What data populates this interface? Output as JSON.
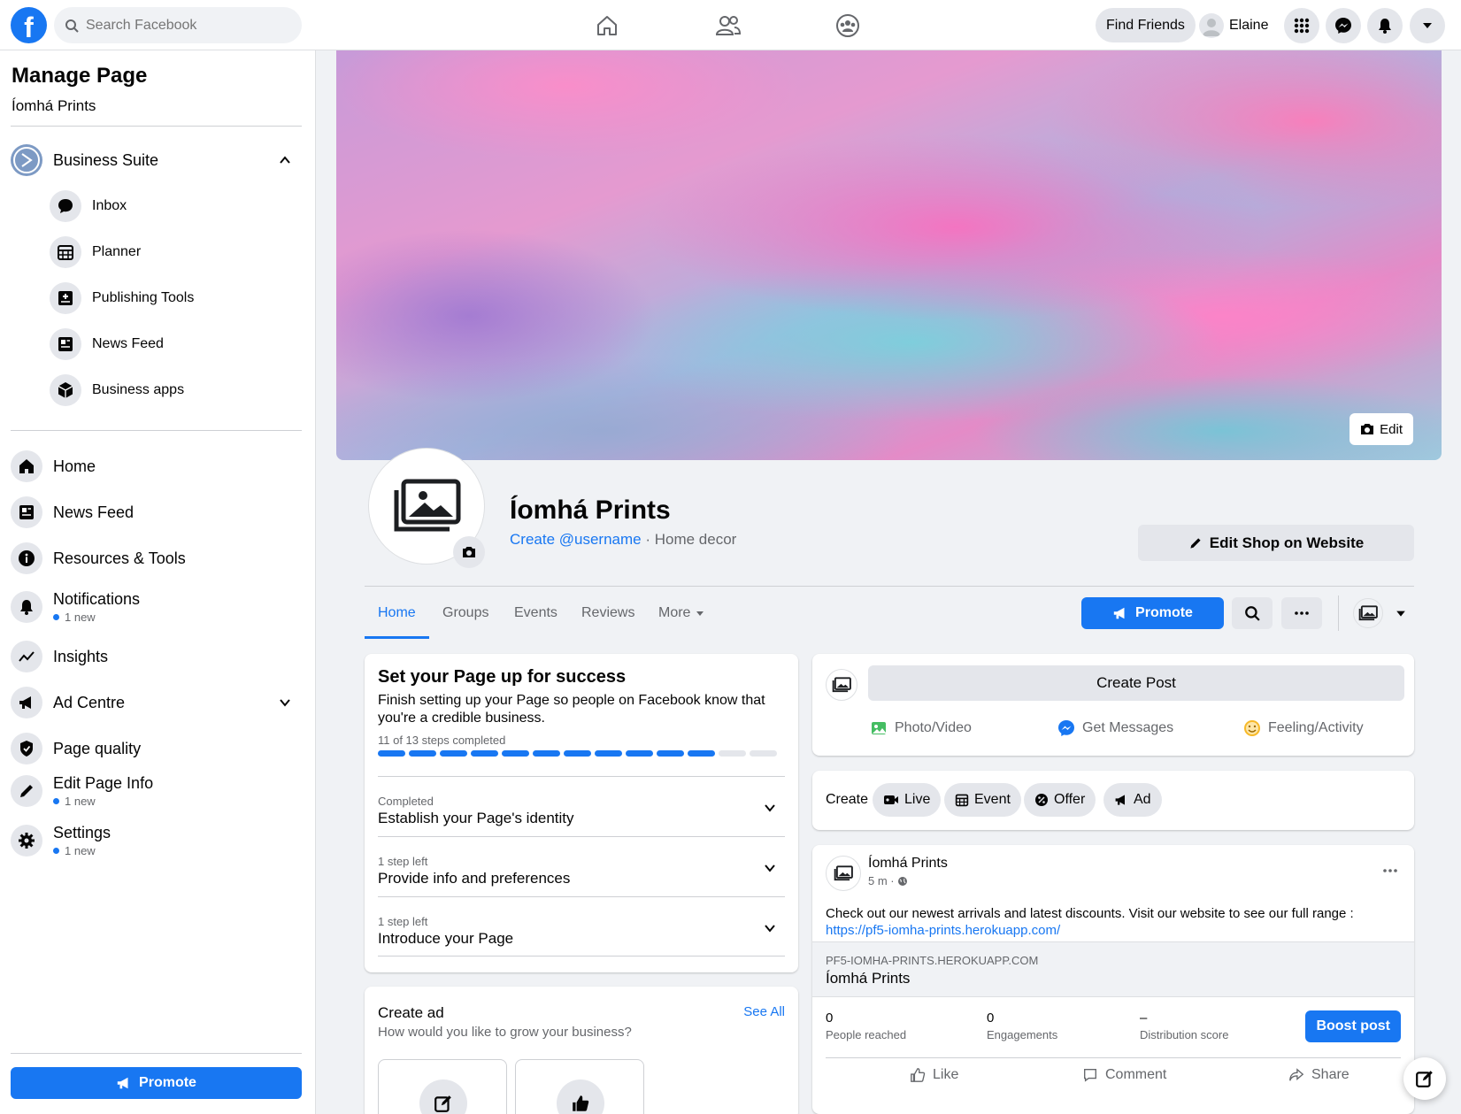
{
  "topbar": {
    "logo": "f",
    "search_placeholder": "Search Facebook",
    "find_friends": "Find Friends",
    "profile_name": "Elaine",
    "nav_icons": [
      "home-icon",
      "friends-icon",
      "groups-icon"
    ],
    "right_icons": [
      "menu-grid-icon",
      "messenger-icon",
      "notifications-icon",
      "account-chevron-icon"
    ]
  },
  "sidebar": {
    "title": "Manage Page",
    "page_name": "Íomhá Prints",
    "business_suite": "Business Suite",
    "suite_items": [
      {
        "label": "Inbox",
        "icon": "inbox-icon"
      },
      {
        "label": "Planner",
        "icon": "planner-icon"
      },
      {
        "label": "Publishing Tools",
        "icon": "publishing-tools-icon"
      },
      {
        "label": "News Feed",
        "icon": "news-feed-icon"
      },
      {
        "label": "Business apps",
        "icon": "business-apps-icon"
      }
    ],
    "items": [
      {
        "label": "Home",
        "icon": "home-icon",
        "badge": ""
      },
      {
        "label": "News Feed",
        "icon": "news-feed-icon",
        "badge": ""
      },
      {
        "label": "Resources & Tools",
        "icon": "info-icon",
        "badge": ""
      },
      {
        "label": "Notifications",
        "icon": "bell-icon",
        "badge": "1 new"
      },
      {
        "label": "Insights",
        "icon": "insights-icon",
        "badge": ""
      },
      {
        "label": "Ad Centre",
        "icon": "megaphone-icon",
        "badge": ""
      },
      {
        "label": "Page quality",
        "icon": "shield-icon",
        "badge": ""
      },
      {
        "label": "Edit Page Info",
        "icon": "pencil-icon",
        "badge": "1 new"
      },
      {
        "label": "Settings",
        "icon": "gear-icon",
        "badge": "1 new"
      }
    ],
    "promote": "Promote"
  },
  "cover": {
    "edit": "Edit"
  },
  "page": {
    "name": "Íomhá Prints",
    "username_link": "Create @username",
    "category": " · Home decor",
    "edit_shop": "Edit Shop on Website"
  },
  "tabs": [
    "Home",
    "Groups",
    "Events",
    "Reviews",
    "More"
  ],
  "actions": {
    "promote": "Promote"
  },
  "setup": {
    "title": "Set your Page up for success",
    "desc": "Finish setting up your Page so people on Facebook know that you're a credible business.",
    "steps": "11 of 13 steps completed",
    "progress_done": 11,
    "progress_total": 13,
    "sections": [
      {
        "small": "Completed",
        "big": "Establish your Page's identity"
      },
      {
        "small": "1 step left",
        "big": "Provide info and preferences"
      },
      {
        "small": "1 step left",
        "big": "Introduce your Page"
      }
    ]
  },
  "create_ad": {
    "title": "Create ad",
    "subtitle": "How would you like to grow your business?",
    "see_all": "See All"
  },
  "composer": {
    "create_post": "Create Post",
    "photo_video": "Photo/Video",
    "get_messages": "Get Messages",
    "feeling": "Feeling/Activity"
  },
  "create_bar": {
    "label": "Create",
    "chips": [
      "Live",
      "Event",
      "Offer",
      "Ad"
    ]
  },
  "post": {
    "author": "Íomhá Prints",
    "time": "5 m ·",
    "text": "Check out our newest arrivals and latest discounts.  Visit our website to see our full range :",
    "link": "https://pf5-iomha-prints.herokuapp.com/",
    "preview_domain": "PF5-IOMHA-PRINTS.HEROKUAPP.COM",
    "preview_title": "Íomhá Prints",
    "stats": [
      {
        "value": "0",
        "label": "People reached"
      },
      {
        "value": "0",
        "label": "Engagements"
      },
      {
        "value": "–",
        "label": "Distribution score"
      }
    ],
    "boost": "Boost post",
    "actions": [
      "Like",
      "Comment",
      "Share"
    ]
  },
  "colors": {
    "brand": "#1877f2",
    "surface": "#ffffff",
    "background": "#f0f2f5",
    "chip": "#e4e6eb"
  }
}
